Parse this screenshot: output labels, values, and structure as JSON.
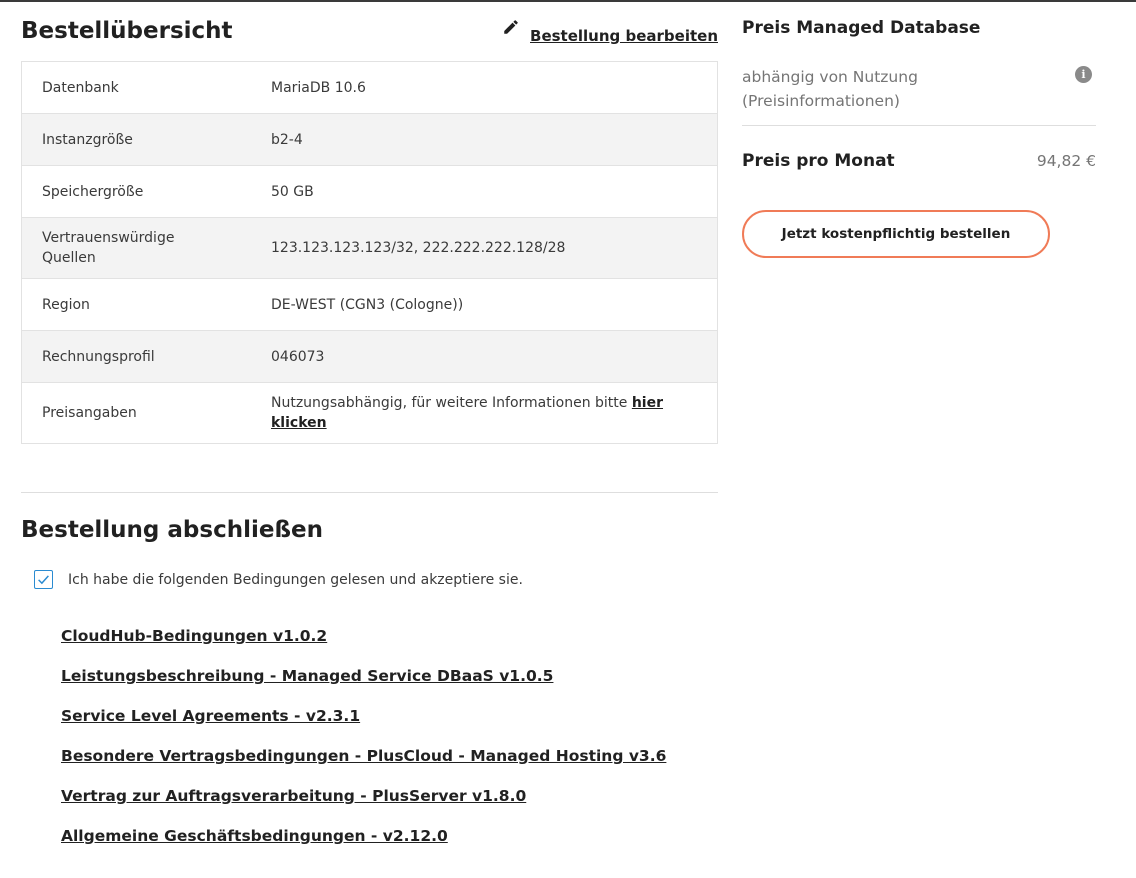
{
  "summary": {
    "title": "Bestellübersicht",
    "edit_label": "Bestellung bearbeiten",
    "rows": [
      {
        "key": "Datenbank",
        "value": "MariaDB 10.6"
      },
      {
        "key": "Instanzgröße",
        "value": "b2-4"
      },
      {
        "key": "Speichergröße",
        "value": "50 GB"
      },
      {
        "key": "Vertrauenswürdige Quellen",
        "value": "123.123.123.123/32, 222.222.222.128/28"
      },
      {
        "key": "Region",
        "value": "DE-WEST (CGN3 (Cologne))"
      },
      {
        "key": "Rechnungsprofil",
        "value": "046073"
      },
      {
        "key": "Preisangaben",
        "value": "Nutzungsabhängig, für weitere Informationen bitte ",
        "link": "hier klicken"
      }
    ]
  },
  "finish": {
    "title": "Bestellung abschließen",
    "accept_label": "Ich habe die folgenden Bedingungen gelesen und akzeptiere sie.",
    "accept_checked": true,
    "terms": [
      "CloudHub-Bedingungen v1.0.2",
      "Leistungsbeschreibung - Managed Service DBaaS v1.0.5",
      "Service Level Agreements - v2.3.1",
      "Besondere Vertragsbedingungen - PlusCloud - Managed Hosting v3.6",
      "Vertrag zur Auftragsverarbeitung - PlusServer v1.8.0",
      "Allgemeine Geschäftsbedingungen - v2.12.0"
    ]
  },
  "price": {
    "title": "Preis Managed Database",
    "usage_text": "abhängig von Nutzung (Preisinformationen)",
    "info_icon": "i",
    "monthly_label": "Preis pro Monat",
    "monthly_value": "94,82 €",
    "order_button": "Jetzt kostenpflichtig bestellen"
  },
  "colors": {
    "accent_orange": "#f07b57",
    "checkbox_blue": "#2a8bd1",
    "text_dark": "#212121",
    "text_muted": "#757575",
    "row_alt": "#f3f3f3"
  }
}
